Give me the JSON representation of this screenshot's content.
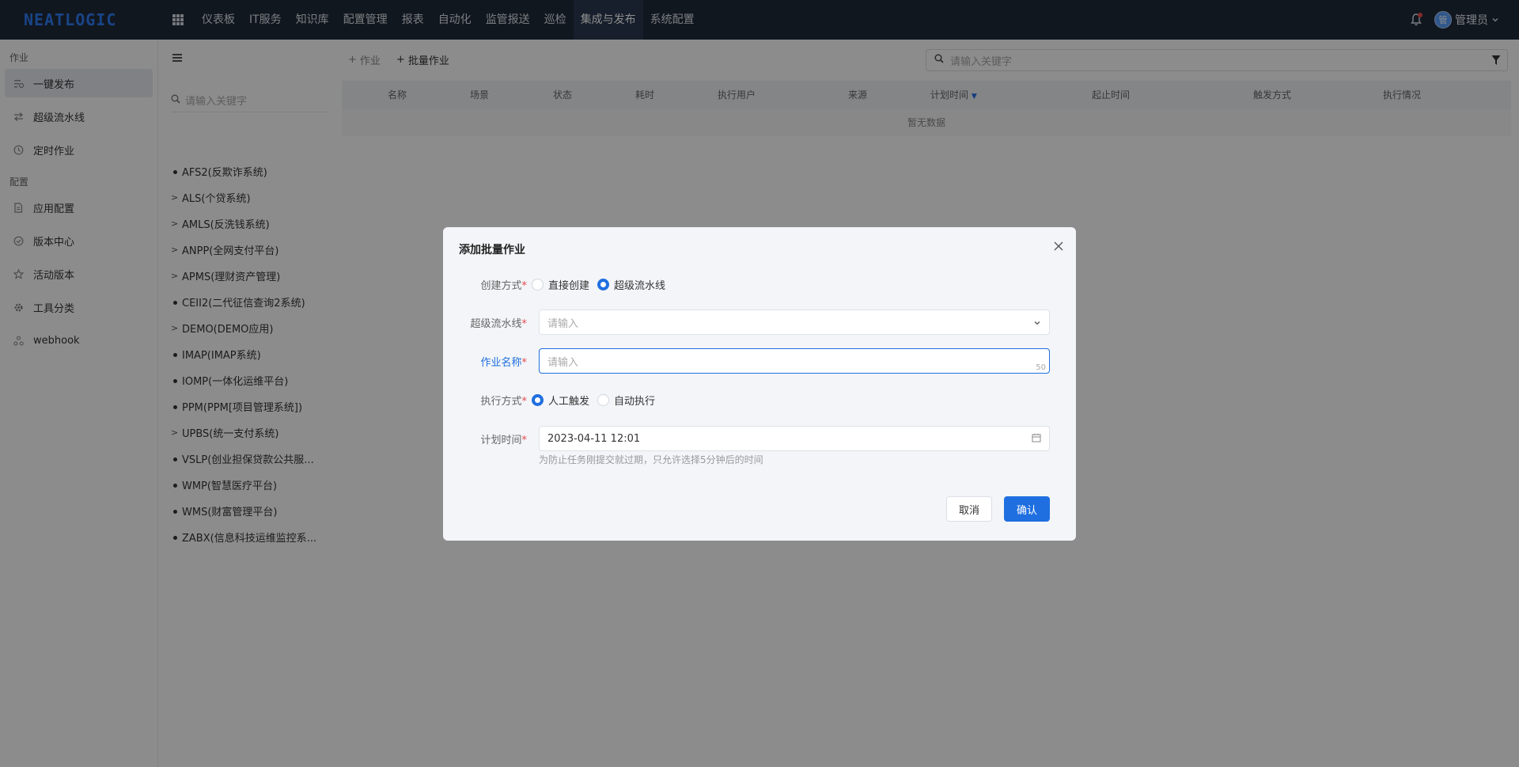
{
  "app": {
    "logo": "NEATLOGIC"
  },
  "nav": {
    "items": [
      {
        "label": "仪表板"
      },
      {
        "label": "IT服务"
      },
      {
        "label": "知识库"
      },
      {
        "label": "配置管理"
      },
      {
        "label": "报表"
      },
      {
        "label": "自动化"
      },
      {
        "label": "监管报送"
      },
      {
        "label": "巡检"
      },
      {
        "label": "集成与发布"
      },
      {
        "label": "系统配置"
      }
    ],
    "active": "集成与发布"
  },
  "user": {
    "avatar_text": "管",
    "name": "管理员"
  },
  "sidebar": {
    "group1": "作业",
    "group2": "配置",
    "items_job": [
      {
        "label": "一键发布",
        "icon": "release-icon"
      },
      {
        "label": "超级流水线",
        "icon": "pipeline-icon"
      },
      {
        "label": "定时作业",
        "icon": "clock-icon"
      }
    ],
    "items_config": [
      {
        "label": "应用配置",
        "icon": "file-icon"
      },
      {
        "label": "版本中心",
        "icon": "version-icon"
      },
      {
        "label": "活动版本",
        "icon": "star-icon"
      },
      {
        "label": "工具分类",
        "icon": "gear-icon"
      },
      {
        "label": "webhook",
        "icon": "webhook-icon"
      }
    ]
  },
  "tree": {
    "search_placeholder": "请输入关键字",
    "items": [
      {
        "label": "AFS2(反欺诈系统)",
        "type": "leaf"
      },
      {
        "label": "ALS(个贷系统)",
        "type": "folder"
      },
      {
        "label": "AMLS(反洗钱系统)",
        "type": "folder"
      },
      {
        "label": "ANPP(全网支付平台)",
        "type": "folder"
      },
      {
        "label": "APMS(理财资产管理)",
        "type": "folder"
      },
      {
        "label": "CEII2(二代征信查询2系统)",
        "type": "leaf"
      },
      {
        "label": "DEMO(DEMO应用)",
        "type": "folder"
      },
      {
        "label": "IMAP(IMAP系统)",
        "type": "leaf"
      },
      {
        "label": "IOMP(一体化运维平台)",
        "type": "leaf"
      },
      {
        "label": "PPM(PPM[项目管理系统])",
        "type": "leaf"
      },
      {
        "label": "UPBS(统一支付系统)",
        "type": "folder"
      },
      {
        "label": "VSLP(创业担保贷款公共服...",
        "type": "leaf"
      },
      {
        "label": "WMP(智慧医疗平台)",
        "type": "leaf"
      },
      {
        "label": "WMS(财富管理平台)",
        "type": "leaf"
      },
      {
        "label": "ZABX(信息科技运维监控系...",
        "type": "leaf"
      }
    ]
  },
  "toolbar": {
    "add_job": "作业",
    "add_batch": "批量作业",
    "search_placeholder": "请输入关键字"
  },
  "table": {
    "columns": [
      "名称",
      "场景",
      "状态",
      "耗时",
      "执行用户",
      "来源",
      "计划时间",
      "起止时间",
      "触发方式",
      "执行情况"
    ],
    "empty_text": "暂无数据"
  },
  "modal": {
    "title": "添加批量作业",
    "create_mode_label": "创建方式",
    "create_mode_options": [
      "直接创建",
      "超级流水线"
    ],
    "create_mode_selected": "超级流水线",
    "pipeline_label": "超级流水线",
    "pipeline_placeholder": "请输入",
    "name_label": "作业名称",
    "name_placeholder": "请输入",
    "name_maxlength": "50",
    "exec_mode_label": "执行方式",
    "exec_mode_options": [
      "人工触发",
      "自动执行"
    ],
    "exec_mode_selected": "人工触发",
    "plan_time_label": "计划时间",
    "plan_time_value": "2023-04-11 12:01",
    "plan_time_hint": "为防止任务刚提交就过期，只允许选择5分钟后的时间",
    "cancel_label": "取消",
    "confirm_label": "确认"
  },
  "colors": {
    "primary": "#1f6fe0",
    "topbar": "#1f2a3a",
    "required": "#e5484d"
  }
}
